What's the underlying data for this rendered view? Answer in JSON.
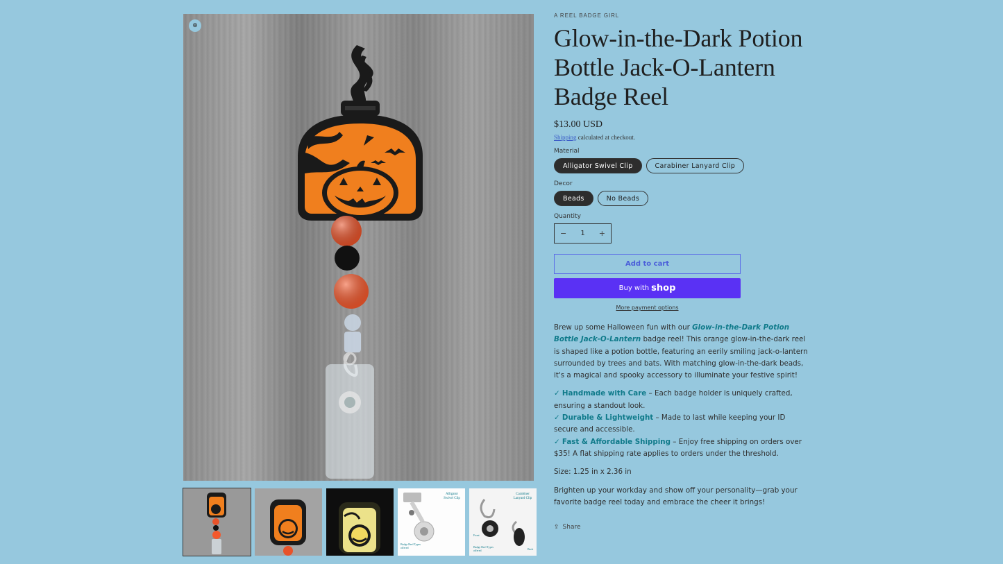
{
  "product": {
    "vendor": "A REEL BADGE GIRL",
    "title": "Glow-in-the-Dark Potion Bottle Jack-O-Lantern Badge Reel",
    "price": "$13.00 USD",
    "shipping_link": "Shipping",
    "shipping_note": " calculated at checkout."
  },
  "options": {
    "material": {
      "label": "Material",
      "values": [
        "Alligator Swivel Clip",
        "Carabiner Lanyard Clip"
      ],
      "selected": "Alligator Swivel Clip"
    },
    "decor": {
      "label": "Decor",
      "values": [
        "Beads",
        "No Beads"
      ],
      "selected": "Beads"
    }
  },
  "quantity": {
    "label": "Quantity",
    "value": "1",
    "minus": "−",
    "plus": "+"
  },
  "buttons": {
    "add_to_cart": "Add to cart",
    "buy_with": "Buy with",
    "shop": "shop",
    "more_payment": "More payment options",
    "share": "Share"
  },
  "description": {
    "intro_1": "Brew up some Halloween fun with our ",
    "intro_hl": "Glow-in-the-Dark Potion Bottle Jack-O-Lantern",
    "intro_2": " badge reel! This orange glow-in-the-dark reel is shaped like a potion bottle, featuring an eerily smiling jack-o-lantern surrounded by trees and bats. With matching glow-in-the-dark beads, it's a magical and spooky accessory to illuminate your festive spirit!",
    "features": [
      {
        "check": "✓",
        "title": "Handmade with Care",
        "text": " – Each badge holder is uniquely crafted, ensuring a standout look."
      },
      {
        "check": "✓",
        "title": "Durable & Lightweight",
        "text": " – Made to last while keeping your ID secure and accessible."
      },
      {
        "check": "✓",
        "title": "Fast & Affordable Shipping",
        "text": " – Enjoy free shipping on orders over $35! A flat shipping rate applies to orders under the threshold."
      }
    ],
    "size": "Size: 1.25 in x 2.36 in",
    "outro": "Brighten up your workday and show off your personality—grab your favorite badge reel today and embrace the cheer it brings!"
  },
  "gallery": {
    "zoom_icon": "zoom-icon",
    "thumbnails": [
      {
        "name": "thumb-full-reel",
        "caption": ""
      },
      {
        "name": "thumb-closeup",
        "caption": ""
      },
      {
        "name": "thumb-glow",
        "caption": ""
      },
      {
        "name": "thumb-alligator-clip",
        "caption": "Alligator Swivel Clip",
        "sub": "Badge Reel Types offered"
      },
      {
        "name": "thumb-carabiner-clip",
        "caption": "Carabiner Lanyard Clip",
        "sub": "Badge Reel Types offered",
        "front": "Front",
        "back": "Back"
      }
    ]
  },
  "colors": {
    "background": "#96c8de",
    "accent_teal": "#0f7a8a",
    "shop_purple": "#5a31f4",
    "pumpkin_orange": "#f07f1e"
  }
}
